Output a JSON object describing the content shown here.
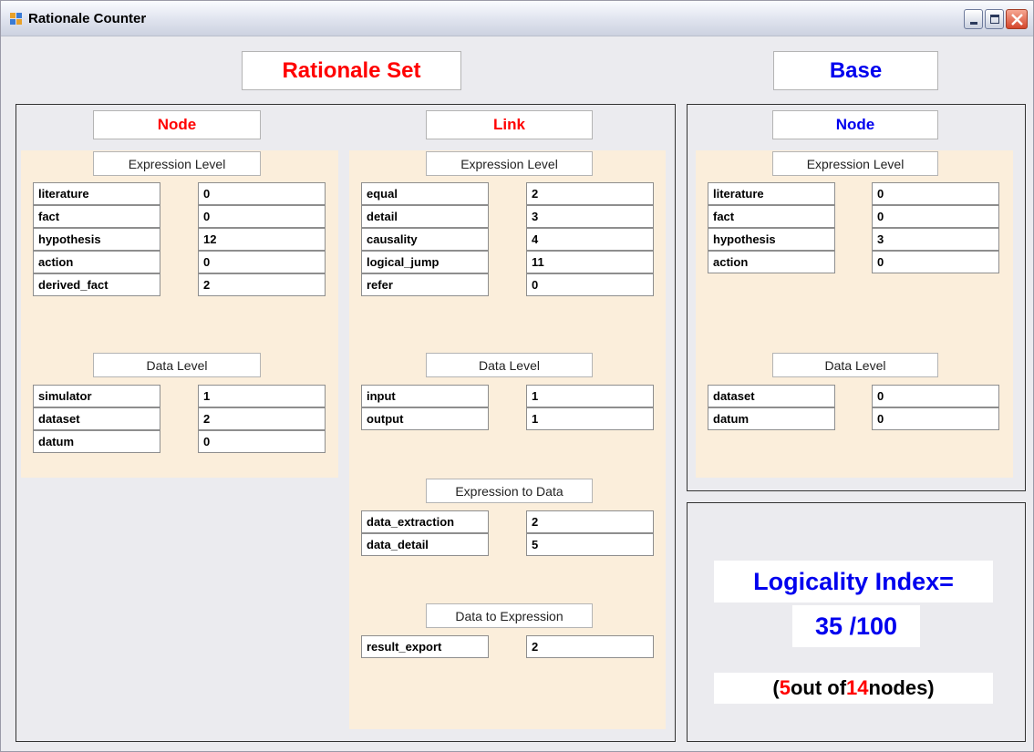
{
  "window": {
    "title": "Rationale Counter"
  },
  "headers": {
    "rationale_set": "Rationale Set",
    "base": "Base"
  },
  "rationale_set": {
    "node": {
      "label": "Node",
      "expression_level": {
        "label": "Expression Level",
        "rows": [
          {
            "name": "literature",
            "value": "0"
          },
          {
            "name": "fact",
            "value": "0"
          },
          {
            "name": "hypothesis",
            "value": "12"
          },
          {
            "name": "action",
            "value": "0"
          },
          {
            "name": "derived_fact",
            "value": "2"
          }
        ]
      },
      "data_level": {
        "label": "Data Level",
        "rows": [
          {
            "name": "simulator",
            "value": "1"
          },
          {
            "name": "dataset",
            "value": "2"
          },
          {
            "name": "datum",
            "value": "0"
          }
        ]
      }
    },
    "link": {
      "label": "Link",
      "expression_level": {
        "label": "Expression Level",
        "rows": [
          {
            "name": "equal",
            "value": "2"
          },
          {
            "name": "detail",
            "value": "3"
          },
          {
            "name": "causality",
            "value": "4"
          },
          {
            "name": "logical_jump",
            "value": "11"
          },
          {
            "name": "refer",
            "value": "0"
          }
        ]
      },
      "data_level": {
        "label": "Data Level",
        "rows": [
          {
            "name": "input",
            "value": "1"
          },
          {
            "name": "output",
            "value": "1"
          }
        ]
      },
      "expression_to_data": {
        "label": "Expression to Data",
        "rows": [
          {
            "name": "data_extraction",
            "value": "2"
          },
          {
            "name": "data_detail",
            "value": "5"
          }
        ]
      },
      "data_to_expression": {
        "label": "Data to Expression",
        "rows": [
          {
            "name": "result_export",
            "value": "2"
          }
        ]
      }
    }
  },
  "base": {
    "node": {
      "label": "Node",
      "expression_level": {
        "label": "Expression Level",
        "rows": [
          {
            "name": "literature",
            "value": "0"
          },
          {
            "name": "fact",
            "value": "0"
          },
          {
            "name": "hypothesis",
            "value": "3"
          },
          {
            "name": "action",
            "value": "0"
          }
        ]
      },
      "data_level": {
        "label": "Data Level",
        "rows": [
          {
            "name": "dataset",
            "value": "0"
          },
          {
            "name": "datum",
            "value": "0"
          }
        ]
      }
    }
  },
  "logicality": {
    "label": "Logicality Index=",
    "score": "35 /100",
    "open_paren": "(",
    "count": "5",
    "out_of": "out of",
    "total": "14",
    "suffix": "nodes)"
  },
  "colors": {
    "rationale_accent": "#ff0000",
    "base_accent": "#0000ee",
    "panel_fill": "#fbeedb",
    "window_bg": "#ebebef"
  }
}
